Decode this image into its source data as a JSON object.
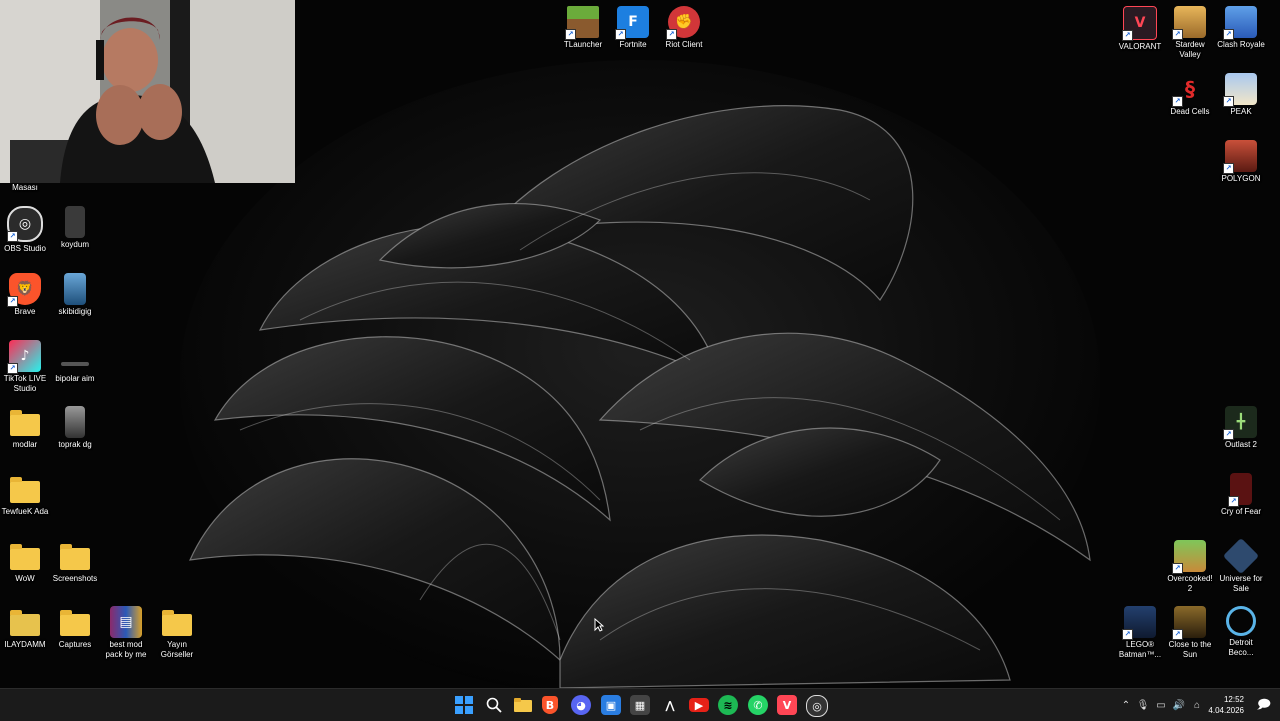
{
  "desktop": {
    "partial_label": "Masası",
    "left_icons": [
      {
        "label": "OBS Studio",
        "icon": "obs-icon",
        "color": "#2b2b2b"
      },
      {
        "label": "koydum",
        "icon": "image-file-icon",
        "color": "#3a3a3a"
      },
      {
        "label": "Brave",
        "icon": "brave-icon",
        "color": "#fb542b"
      },
      {
        "label": "skibidigig",
        "icon": "image-file-icon",
        "color": "#2a6fb0"
      },
      {
        "label": "TikTok LIVE Studio",
        "icon": "tiktok-icon",
        "color": "#fe2c55"
      },
      {
        "label": "bipolar aim",
        "icon": "image-file-icon",
        "color": "#555555"
      },
      {
        "label": "modlar",
        "icon": "folder-icon",
        "color": "#f5c84a"
      },
      {
        "label": "toprak dg",
        "icon": "image-file-icon",
        "color": "#777777"
      },
      {
        "label": "TewfueK Ada",
        "icon": "folder-icon",
        "color": "#f5c84a"
      },
      {
        "label": "WoW",
        "icon": "folder-icon",
        "color": "#f5c84a"
      },
      {
        "label": "Screenshots",
        "icon": "folder-icon",
        "color": "#f5c84a"
      },
      {
        "label": "ILAYDAMM",
        "icon": "folder-icon",
        "color": "#f5c84a"
      },
      {
        "label": "Captures",
        "icon": "folder-icon",
        "color": "#f5c84a"
      },
      {
        "label": "best mod pack by me",
        "icon": "winrar-icon",
        "color": "#8b2a6b"
      },
      {
        "label": "Yayın Görseller",
        "icon": "folder-icon",
        "color": "#f5c84a"
      }
    ],
    "top_icons": [
      {
        "label": "TLauncher",
        "icon": "minecraft-icon",
        "color": "#5b8c32"
      },
      {
        "label": "Fortnite",
        "icon": "fortnite-icon",
        "color": "#1d7fe0",
        "glyph": "F"
      },
      {
        "label": "Riot Client",
        "icon": "riot-icon",
        "color": "#d13639"
      }
    ],
    "right_icons": [
      {
        "label": "VALORANT",
        "icon": "valorant-icon",
        "color": "#2a1a22",
        "glyph": "V"
      },
      {
        "label": "Stardew Valley",
        "icon": "stardew-icon",
        "color": "#c9873a"
      },
      {
        "label": "Clash Royale",
        "icon": "clash-royale-icon",
        "color": "#3b7fd1"
      },
      {
        "label": "Dead Cells",
        "icon": "dead-cells-icon",
        "color": "#b51e24"
      },
      {
        "label": "PEAK",
        "icon": "peak-icon",
        "color": "#7fa6d8"
      },
      {
        "label": "POLYGON",
        "icon": "polygon-icon",
        "color": "#b4382a"
      },
      {
        "label": "Outlast 2",
        "icon": "outlast-icon",
        "color": "#1c2a1c"
      },
      {
        "label": "Cry of Fear",
        "icon": "cry-of-fear-icon",
        "color": "#5a1212"
      },
      {
        "label": "Overcooked! 2",
        "icon": "overcooked-icon",
        "color": "#4a9a3a"
      },
      {
        "label": "Universe for Sale",
        "icon": "universe-for-sale-icon",
        "color": "#2e4a6e"
      },
      {
        "label": "LEGO® Batman™...",
        "icon": "lego-batman-icon",
        "color": "#23406e"
      },
      {
        "label": "Close to the Sun",
        "icon": "close-to-the-sun-icon",
        "color": "#6b5320"
      },
      {
        "label": "Detroit Beco...",
        "icon": "detroit-icon",
        "color": "#1a1a1a"
      }
    ]
  },
  "taskbar": {
    "apps": [
      {
        "name": "start",
        "icon": "windows-start-icon",
        "color": "#3aa0ff",
        "glyph": "⊞"
      },
      {
        "name": "search",
        "icon": "search-icon",
        "color": "#1b1b1b",
        "glyph": "⌕"
      },
      {
        "name": "file-explorer",
        "icon": "folder-icon",
        "color": "#f5c84a",
        "glyph": ""
      },
      {
        "name": "brave",
        "icon": "brave-icon",
        "color": "#fb542b",
        "glyph": "B"
      },
      {
        "name": "discord",
        "icon": "discord-icon",
        "color": "#5865f2",
        "glyph": "D"
      },
      {
        "name": "store",
        "icon": "store-icon",
        "color": "#2a7de1",
        "glyph": "▣"
      },
      {
        "name": "calculator",
        "icon": "calculator-icon",
        "color": "#444444",
        "glyph": "▦"
      },
      {
        "name": "nvidia",
        "icon": "nvidia-icon",
        "color": "#1b1b1b",
        "glyph": "⋀"
      },
      {
        "name": "youtube",
        "icon": "youtube-icon",
        "color": "#e62117",
        "glyph": "▶"
      },
      {
        "name": "spotify",
        "icon": "spotify-icon",
        "color": "#1db954",
        "glyph": "≋"
      },
      {
        "name": "whatsapp",
        "icon": "whatsapp-icon",
        "color": "#25d366",
        "glyph": "✆"
      },
      {
        "name": "valorant",
        "icon": "valorant-icon",
        "color": "#ff4655",
        "glyph": "V"
      },
      {
        "name": "obs",
        "icon": "obs-icon",
        "color": "#333333",
        "glyph": "◎"
      }
    ],
    "time": "12:52",
    "date": "4.04.2026"
  }
}
